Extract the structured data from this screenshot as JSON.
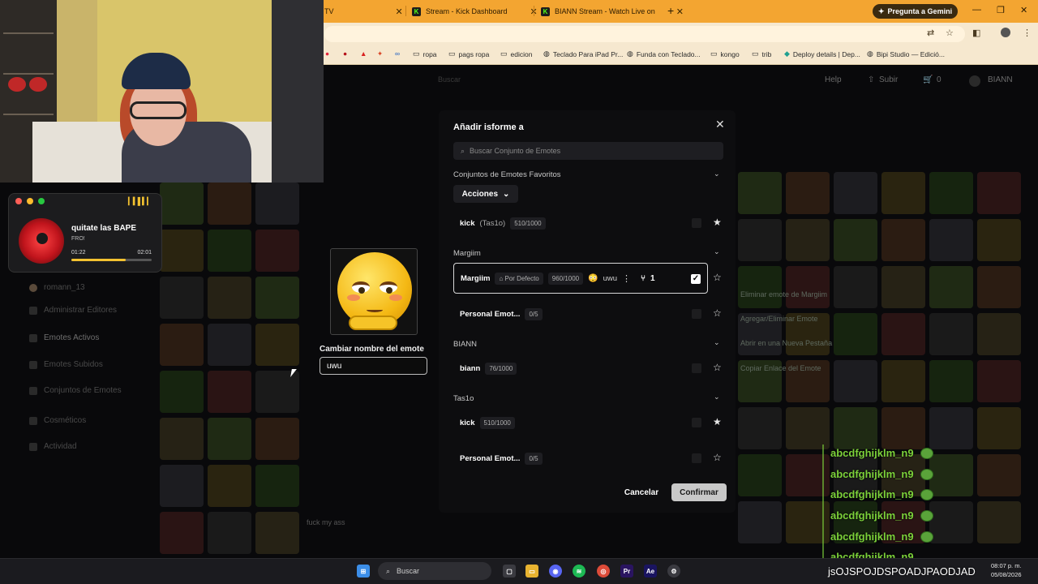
{
  "browser": {
    "tabs": [
      {
        "label": "TV",
        "favicon": "tv-favicon"
      },
      {
        "label": "Stream - Kick Dashboard",
        "favicon": "kick-favicon"
      },
      {
        "label": "BIANN Stream - Watch Live on",
        "favicon": "kick-favicon"
      }
    ],
    "gemini_label": "Pregunta a Gemini",
    "bookmarks": [
      "ropa",
      "pags ropa",
      "edicion",
      "Teclado Para iPad Pr...",
      "Funda con Teclado...",
      "kongo",
      "trib",
      "Deploy details | Dep...",
      "Bipi Studio — Edició..."
    ]
  },
  "site": {
    "search_placeholder": "Buscar",
    "nav": {
      "help": "Help",
      "upload": "Subir",
      "cart_count": "0",
      "user": "BIANN"
    },
    "sidebar": [
      "romann_13",
      "Administrar Editores",
      "Emotes Activos",
      "Emotes Subidos",
      "Conjuntos de Emotes",
      "Cosméticos",
      "Actividad"
    ],
    "context_menu": [
      "Eliminar emote de Margiim",
      "Agregar/Eliminar Emote",
      "Abrir en una Nueva Pestaña",
      "Copiar Enlace del Emote"
    ],
    "grid_caption": "fuck my ass"
  },
  "player": {
    "song": "quitate las BAPE",
    "artist": "FRO!",
    "time_current": "01:22",
    "time_total": "02:01",
    "progress": 0.68
  },
  "preview": {
    "rename_label": "Cambiar nombre del emote",
    "rename_value": "uwu"
  },
  "modal": {
    "title": "Añadir isforme a",
    "search_placeholder": "Buscar Conjunto de Emotes",
    "favorites_label": "Conjuntos de Emotes Favoritos",
    "actions_label": "Acciones",
    "sections": [
      {
        "label": "Margiim"
      },
      {
        "label": "BIANN"
      },
      {
        "label": "Tas1o"
      }
    ],
    "rows": {
      "fav_kick": {
        "name": "kick",
        "owner": "(Tas1o)",
        "count": "510/1000"
      },
      "margiim": {
        "name": "Margiim",
        "default_badge": "Por Defecto",
        "count": "960/1000",
        "alias": "uwu",
        "forks": "1"
      },
      "margiim_personal": {
        "name": "Personal Emot...",
        "count": "0/5"
      },
      "biann": {
        "name": "biann",
        "count": "76/1000"
      },
      "tas1o_kick": {
        "name": "kick",
        "count": "510/1000"
      },
      "tas1o_personal": {
        "name": "Personal Emot...",
        "count": "0/5"
      }
    },
    "cancel_label": "Cancelar",
    "confirm_label": "Confirmar"
  },
  "chat": {
    "lines": [
      "abcdfghijklm_n9",
      "abcdfghijklm_n9",
      "abcdfghijklm_n9",
      "abcdfghijklm_n9",
      "abcdfghijklm_n9",
      "abcdfghijklm_n9"
    ],
    "last": "jsOJSPOJDSPOADJPAODJAD"
  },
  "taskbar": {
    "search_label": "Buscar",
    "time": "08:07 p. m.",
    "date": "05/08/2026"
  },
  "colors": {
    "tab_bar": "#f3a531",
    "kick_green": "#53fc18",
    "chat_green": "#7cd13a",
    "player_accent": "#f3c230"
  }
}
